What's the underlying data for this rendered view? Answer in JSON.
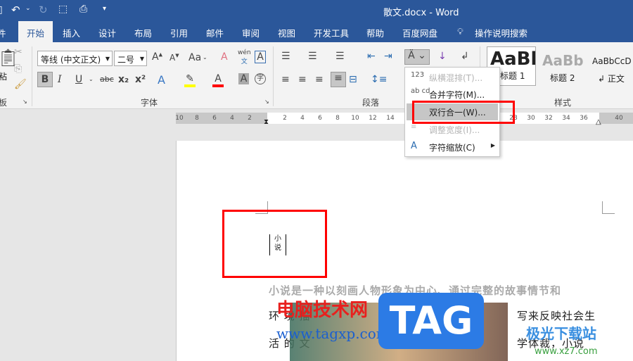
{
  "title": "散文.docx  -  Word",
  "quick_access": {
    "undo": "undo-icon",
    "redo": "redo-icon"
  },
  "tabs": [
    {
      "label": "件"
    },
    {
      "label": "开始"
    },
    {
      "label": "插入"
    },
    {
      "label": "设计"
    },
    {
      "label": "布局"
    },
    {
      "label": "引用"
    },
    {
      "label": "邮件"
    },
    {
      "label": "审阅"
    },
    {
      "label": "视图"
    },
    {
      "label": "开发工具"
    },
    {
      "label": "帮助"
    },
    {
      "label": "百度网盘"
    }
  ],
  "tell_me": "操作说明搜索",
  "ribbon": {
    "clipboard_label": "板",
    "paste_label": "粘",
    "font": {
      "name": "等线 (中文正文)",
      "size": "二号",
      "label": "字体",
      "aa": "Aa",
      "bold": "B",
      "italic": "I",
      "underline": "U",
      "strike": "abc",
      "sub": "x₂",
      "sup": "x²",
      "phonetic": "wén",
      "phonetic_sub": "文",
      "border_a": "A",
      "enclose": "字"
    },
    "paragraph_label": "段落",
    "styles": {
      "label": "样式",
      "items": [
        {
          "preview": "AaBl",
          "name": "标题 1"
        },
        {
          "preview": "AaBb(",
          "name": "标题 2"
        },
        {
          "preview": "AaBbCcD",
          "name": "↲ 正文"
        }
      ]
    }
  },
  "ruler": {
    "left": [
      "10",
      "8",
      "6",
      "4",
      "2"
    ],
    "right": [
      "2",
      "4",
      "6",
      "8",
      "10",
      "12",
      "14",
      "28",
      "30",
      "32",
      "34",
      "36",
      "40"
    ]
  },
  "menu": {
    "items": [
      {
        "icon": "123",
        "label": "纵横混排(T)...",
        "disabled": true
      },
      {
        "icon": "ab cd",
        "label": "合并字符(M)...",
        "disabled": false
      },
      {
        "icon": "",
        "label": "双行合一(W)...",
        "disabled": false,
        "highlighted": true
      },
      {
        "icon": "≡",
        "label": "调整宽度(I)...",
        "disabled": true
      },
      {
        "icon": "A",
        "label": "字符缩放(C)",
        "disabled": false,
        "submenu": true
      }
    ]
  },
  "document": {
    "combined_top": "小",
    "combined_bottom": "说",
    "lines": [
      "小说是一种以刻画人物形象为中心、通过完整的故事情节和",
      "环 境 描",
      "写来反映社会生",
      "活 的 文",
      "学体裁，小说"
    ]
  },
  "watermarks": {
    "site1": "电脑技术网",
    "site1_url": "www.tagxp.com",
    "tag": "TAG",
    "site2": "极光下载站",
    "site2_url": "www.xz7.com"
  },
  "colors": {
    "accent": "#2b579a",
    "highlight_box": "#ff0000"
  }
}
